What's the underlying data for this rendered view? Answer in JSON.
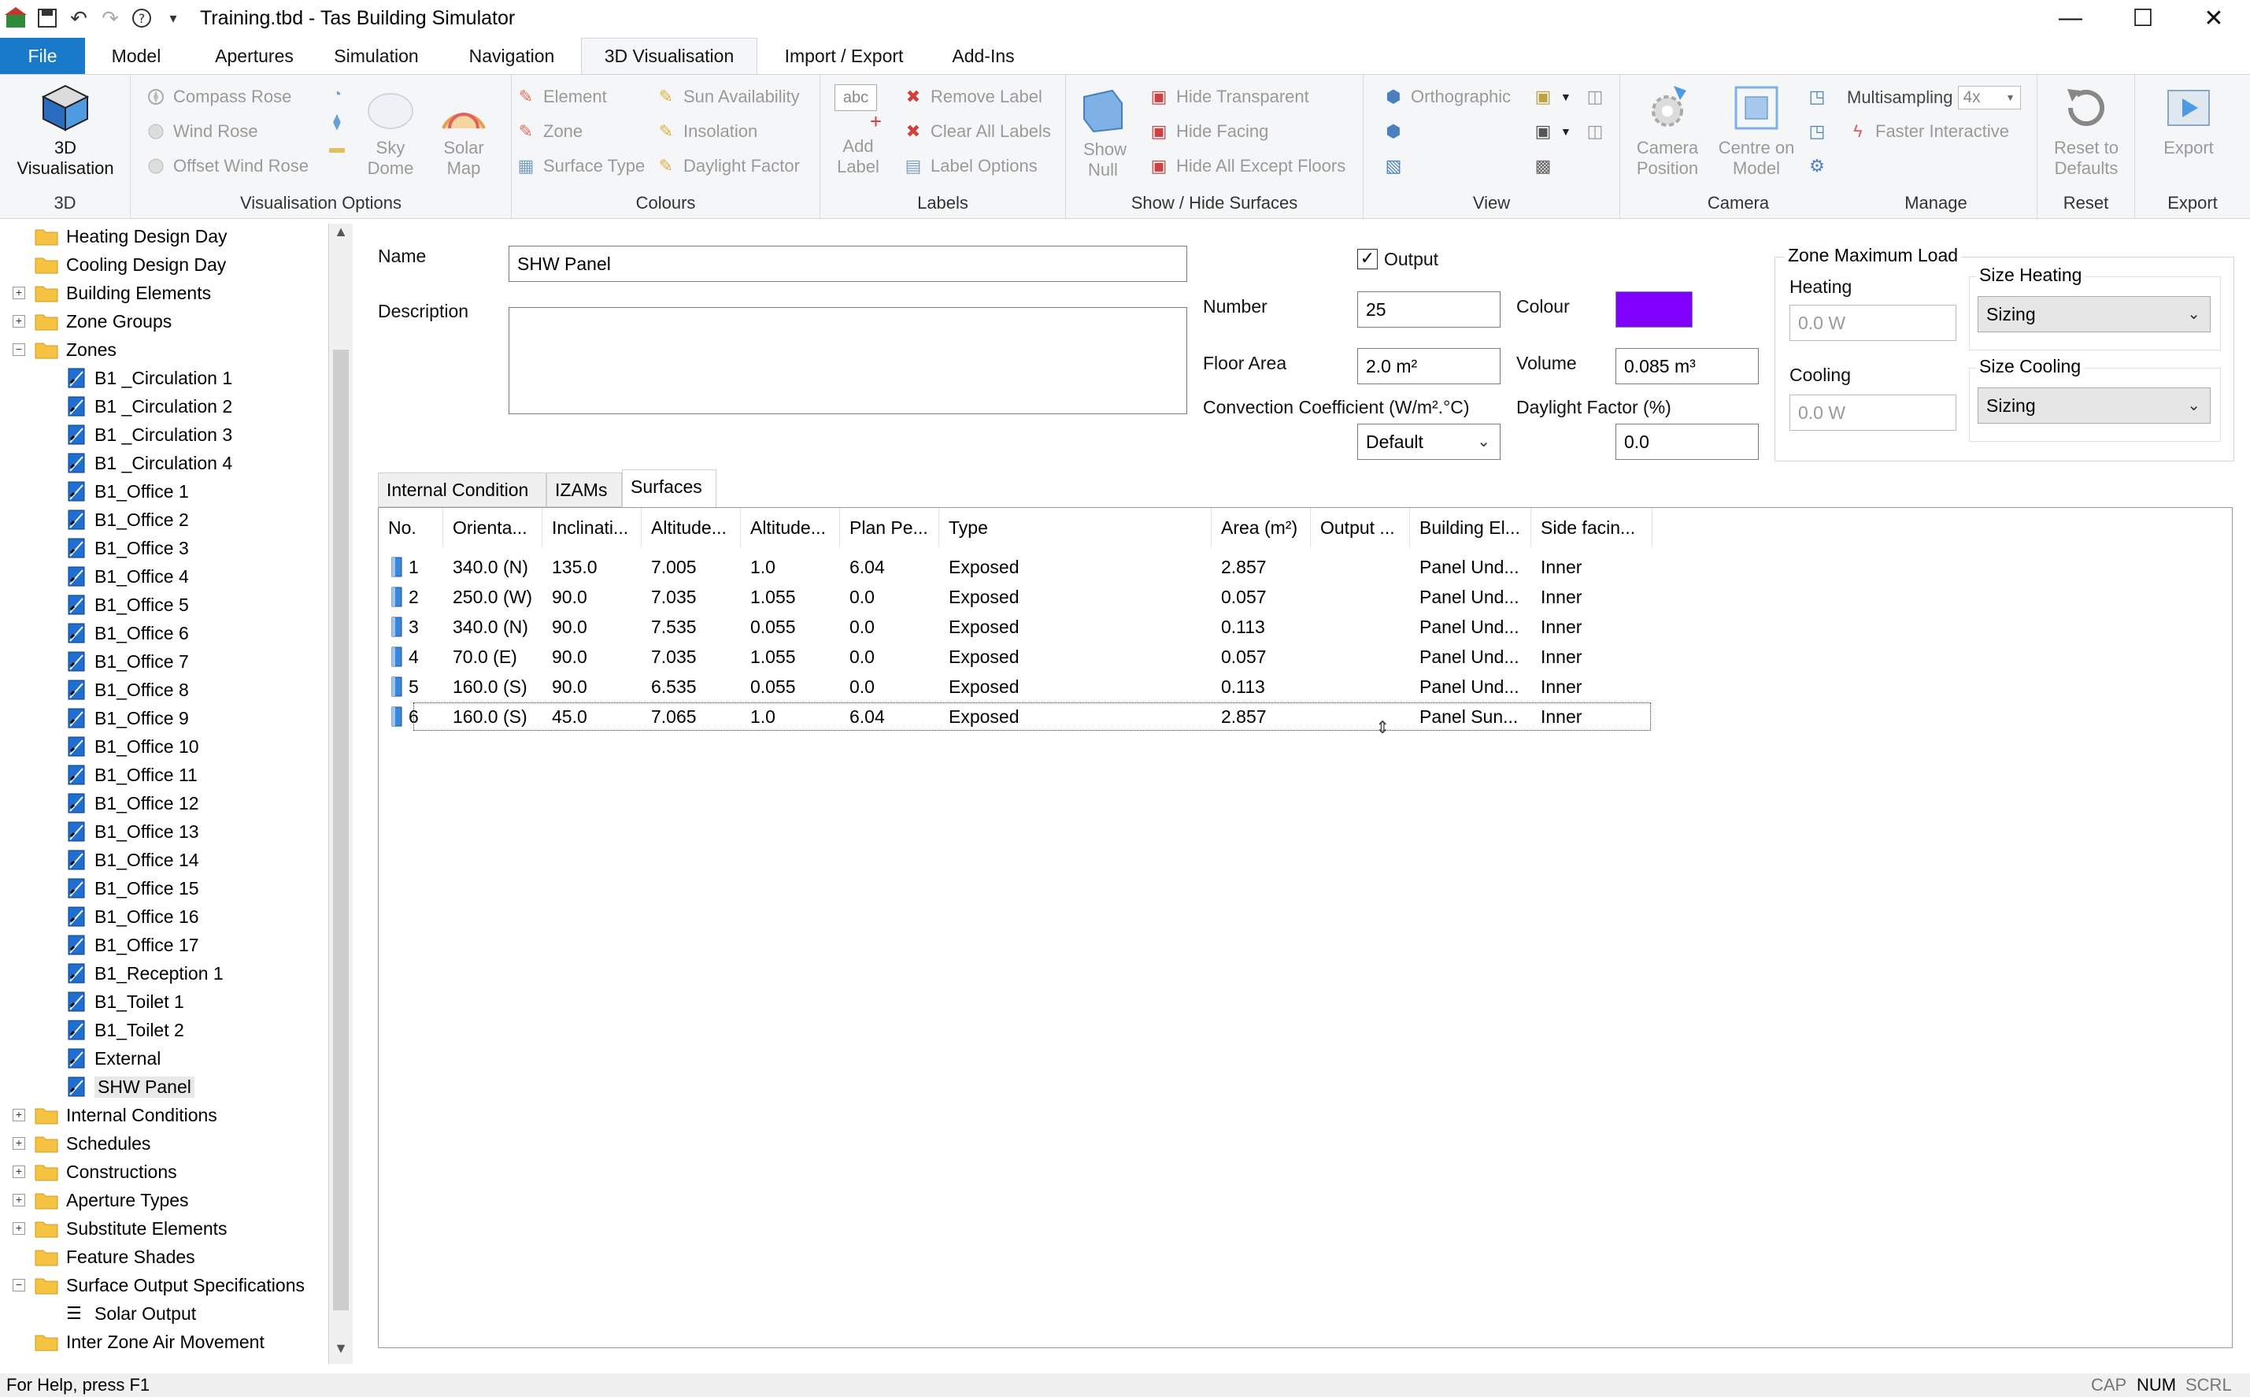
{
  "window": {
    "title": "Training.tbd - Tas Building Simulator",
    "minimize": "—",
    "maximize": "☐",
    "close": "✕"
  },
  "menu": {
    "file": "File",
    "tabs": [
      "Model",
      "Apertures",
      "Simulation",
      "Navigation",
      "3D Visualisation",
      "Import / Export",
      "Add-Ins"
    ]
  },
  "ribbon": {
    "g3d": {
      "button": "3D Visualisation",
      "label": "3D"
    },
    "vis": {
      "label": "Visualisation Options",
      "compass": "Compass Rose",
      "wind": "Wind Rose",
      "offset": "Offset Wind Rose",
      "sky": "Sky Dome",
      "solar": "Solar Map"
    },
    "colours": {
      "label": "Colours",
      "element": "Element",
      "zone": "Zone",
      "surface": "Surface Type",
      "sun": "Sun Availability",
      "insolation": "Insolation",
      "daylight": "Daylight Factor"
    },
    "labels": {
      "label": "Labels",
      "add": "Add Label",
      "remove": "Remove Label",
      "clear": "Clear All Labels",
      "options": "Label Options",
      "abc": "abc"
    },
    "showhide": {
      "label": "Show / Hide Surfaces",
      "null": "Show Null",
      "transparent": "Hide Transparent",
      "facing": "Hide Facing",
      "except": "Hide All Except Floors"
    },
    "view": {
      "label": "View",
      "ortho": "Orthographic"
    },
    "camera": {
      "label": "Camera",
      "position": "Camera Position",
      "centre": "Centre on Model"
    },
    "manage": {
      "label": "Manage",
      "multisampling": "Multisampling",
      "ms_value": "4x",
      "faster": "Faster Interactive"
    },
    "reset": {
      "label": "Reset",
      "button": "Reset to Defaults"
    },
    "export": {
      "label": "Export",
      "button": "Export"
    }
  },
  "tree": {
    "top": [
      "Heating Design Day",
      "Cooling Design Day",
      "Building Elements",
      "Zone Groups",
      "Zones"
    ],
    "zones": [
      "B1 _Circulation 1",
      "B1 _Circulation 2",
      "B1 _Circulation 3",
      "B1 _Circulation 4",
      "B1_Office 1",
      "B1_Office 2",
      "B1_Office 3",
      "B1_Office 4",
      "B1_Office 5",
      "B1_Office 6",
      "B1_Office 7",
      "B1_Office 8",
      "B1_Office 9",
      "B1_Office 10",
      "B1_Office 11",
      "B1_Office 12",
      "B1_Office 13",
      "B1_Office 14",
      "B1_Office 15",
      "B1_Office 16",
      "B1_Office 17",
      "B1_Reception 1",
      "B1_Toilet 1",
      "B1_Toilet 2",
      "External",
      "SHW Panel"
    ],
    "bottom": [
      "Internal Conditions",
      "Schedules",
      "Constructions",
      "Aperture Types",
      "Substitute Elements",
      "Feature Shades",
      "Surface Output Specifications"
    ],
    "solar_output": "Solar Output",
    "last": "Inter Zone Air Movement"
  },
  "zone": {
    "name_label": "Name",
    "name": "SHW Panel",
    "description_label": "Description",
    "description": "",
    "output_label": "Output",
    "number_label": "Number",
    "number": "25",
    "colour_label": "Colour",
    "colour": "#8000ff",
    "floor_area_label": "Floor Area",
    "floor_area": "2.0 m²",
    "volume_label": "Volume",
    "volume": "0.085 m³",
    "convection_label": "Convection Coefficient (W/m².°C)",
    "convection": "Default",
    "daylight_label": "Daylight Factor (%)",
    "daylight": "0.0"
  },
  "max_load": {
    "title": "Zone Maximum Load",
    "heating_label": "Heating",
    "heating": "0.0 W",
    "size_heating_label": "Size Heating",
    "size_heating": "Sizing",
    "cooling_label": "Cooling",
    "cooling": "0.0 W",
    "size_cooling_label": "Size Cooling",
    "size_cooling": "Sizing"
  },
  "subtabs": [
    "Internal Condition",
    "IZAMs",
    "Surfaces"
  ],
  "grid": {
    "columns": [
      "No.",
      "Orienta...",
      "Inclinati...",
      "Altitude...",
      "Altitude...",
      "Plan Pe...",
      "Type",
      "Area (m²)",
      "Output ...",
      "Building El...",
      "Side facin..."
    ],
    "rows": [
      [
        "1",
        "340.0 (N)",
        "135.0",
        "7.005",
        "1.0",
        "6.04",
        "Exposed",
        "2.857",
        "",
        "Panel Und...",
        "Inner"
      ],
      [
        "2",
        "250.0 (W)",
        "90.0",
        "7.035",
        "1.055",
        "0.0",
        "Exposed",
        "0.057",
        "",
        "Panel Und...",
        "Inner"
      ],
      [
        "3",
        "340.0 (N)",
        "90.0",
        "7.535",
        "0.055",
        "0.0",
        "Exposed",
        "0.113",
        "",
        "Panel Und...",
        "Inner"
      ],
      [
        "4",
        "70.0 (E)",
        "90.0",
        "7.035",
        "1.055",
        "0.0",
        "Exposed",
        "0.057",
        "",
        "Panel Und...",
        "Inner"
      ],
      [
        "5",
        "160.0 (S)",
        "90.0",
        "6.535",
        "0.055",
        "0.0",
        "Exposed",
        "0.113",
        "",
        "Panel Und...",
        "Inner"
      ],
      [
        "6",
        "160.0 (S)",
        "45.0",
        "7.065",
        "1.0",
        "6.04",
        "Exposed",
        "2.857",
        "",
        "Panel Sun...",
        "Inner"
      ]
    ]
  },
  "status": {
    "text": "For Help, press F1",
    "cap": "CAP",
    "num": "NUM",
    "scrl": "SCRL"
  }
}
